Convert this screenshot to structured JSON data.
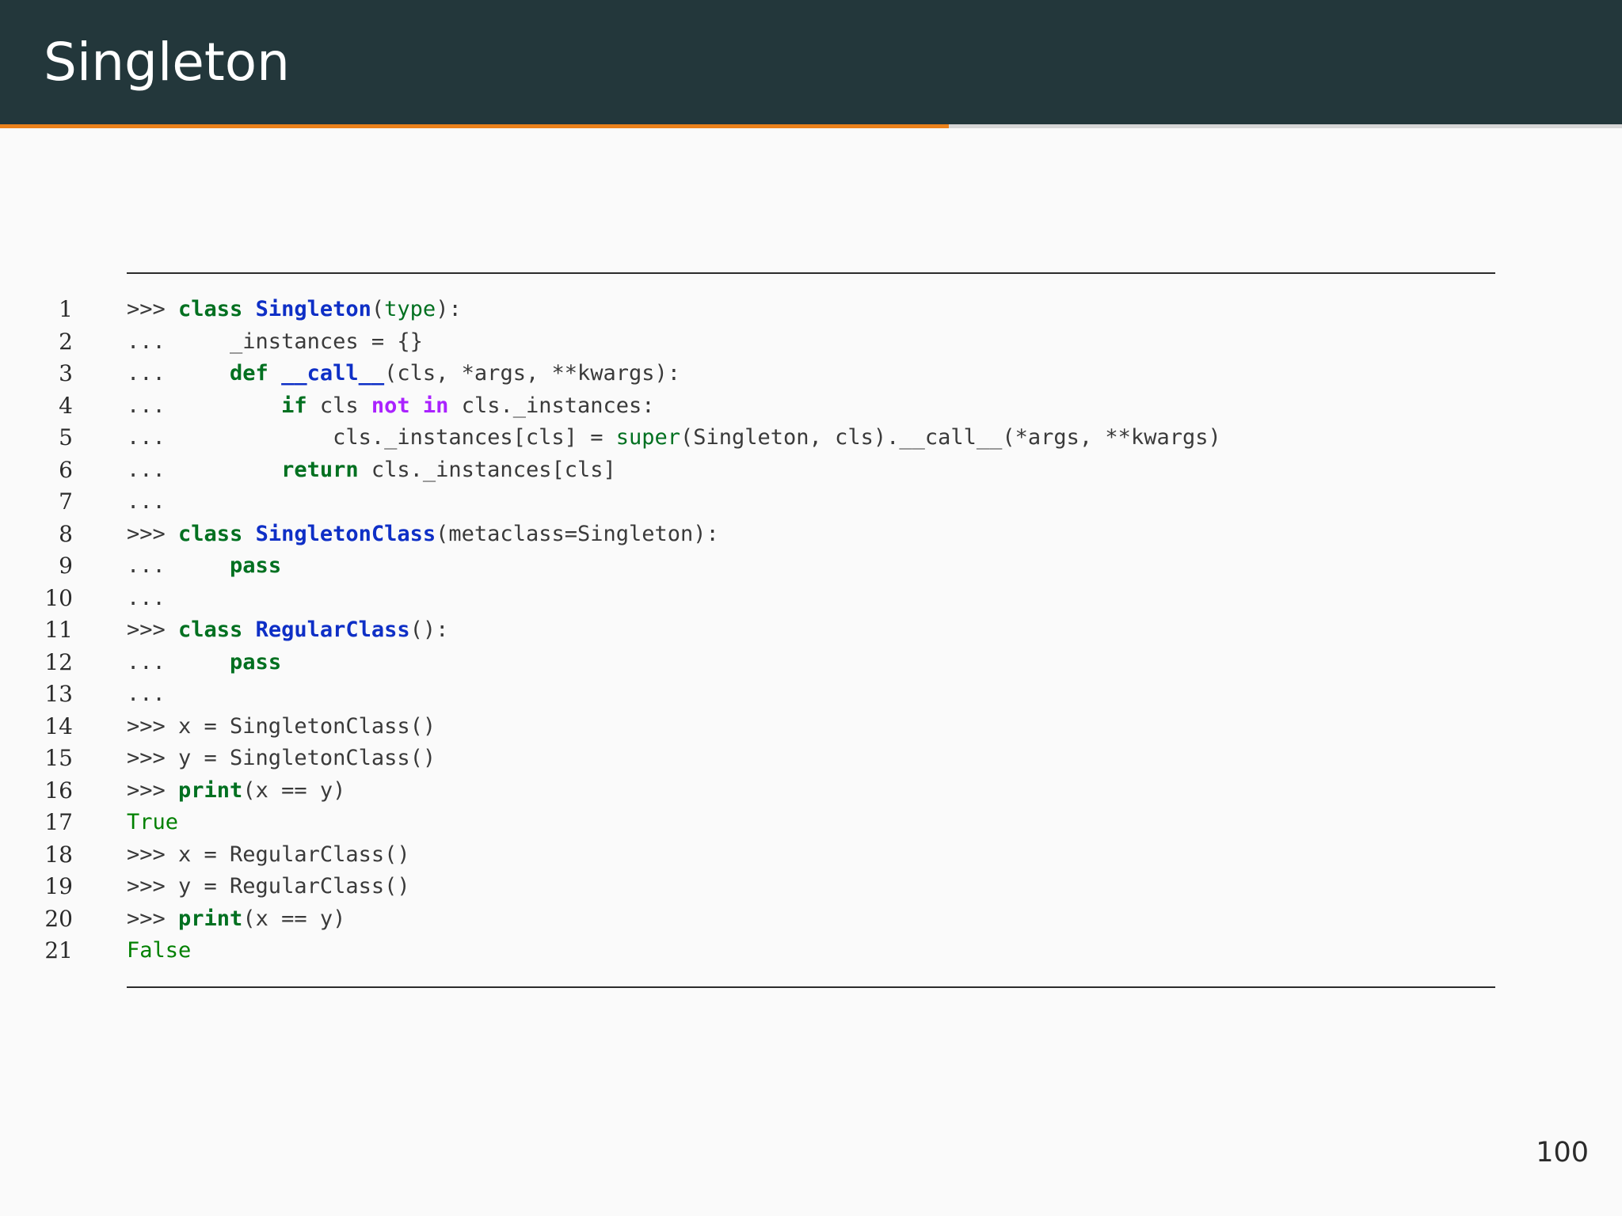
{
  "slide": {
    "title": "Singleton",
    "page_number": "100",
    "progress_fraction": 0.585,
    "colors": {
      "header_bg": "#23373b",
      "accent": "#eb811b",
      "keyword": "#007020",
      "class_name": "#0e2fc6",
      "operator": "#aa22ff"
    }
  },
  "code": {
    "lines": [
      {
        "n": "1",
        "parts": [
          {
            "t": ">>> "
          },
          {
            "t": "class",
            "c": "kw"
          },
          {
            "t": " "
          },
          {
            "t": "Singleton",
            "c": "nc"
          },
          {
            "t": "("
          },
          {
            "t": "type",
            "c": "nb"
          },
          {
            "t": "):"
          }
        ]
      },
      {
        "n": "2",
        "parts": [
          {
            "t": "...     _instances = {}"
          }
        ]
      },
      {
        "n": "3",
        "parts": [
          {
            "t": "...     "
          },
          {
            "t": "def",
            "c": "kw"
          },
          {
            "t": " "
          },
          {
            "t": "__call__",
            "c": "nc"
          },
          {
            "t": "(cls, *args, **kwargs):"
          }
        ]
      },
      {
        "n": "4",
        "parts": [
          {
            "t": "...         "
          },
          {
            "t": "if",
            "c": "kw"
          },
          {
            "t": " cls "
          },
          {
            "t": "not",
            "c": "op"
          },
          {
            "t": " "
          },
          {
            "t": "in",
            "c": "op"
          },
          {
            "t": " cls._instances:"
          }
        ]
      },
      {
        "n": "5",
        "parts": [
          {
            "t": "...             cls._instances[cls] = "
          },
          {
            "t": "super",
            "c": "nb"
          },
          {
            "t": "(Singleton, cls).__call__(*args, **kwargs)"
          }
        ]
      },
      {
        "n": "6",
        "parts": [
          {
            "t": "...         "
          },
          {
            "t": "return",
            "c": "kw"
          },
          {
            "t": " cls._instances[cls]"
          }
        ]
      },
      {
        "n": "7",
        "parts": [
          {
            "t": "..."
          }
        ]
      },
      {
        "n": "8",
        "parts": [
          {
            "t": ">>> "
          },
          {
            "t": "class",
            "c": "kw"
          },
          {
            "t": " "
          },
          {
            "t": "SingletonClass",
            "c": "nc"
          },
          {
            "t": "(metaclass=Singleton):"
          }
        ]
      },
      {
        "n": "9",
        "parts": [
          {
            "t": "...     "
          },
          {
            "t": "pass",
            "c": "kw"
          }
        ]
      },
      {
        "n": "10",
        "parts": [
          {
            "t": "..."
          }
        ]
      },
      {
        "n": "11",
        "parts": [
          {
            "t": ">>> "
          },
          {
            "t": "class",
            "c": "kw"
          },
          {
            "t": " "
          },
          {
            "t": "RegularClass",
            "c": "nc"
          },
          {
            "t": "():"
          }
        ]
      },
      {
        "n": "12",
        "parts": [
          {
            "t": "...     "
          },
          {
            "t": "pass",
            "c": "kw"
          }
        ]
      },
      {
        "n": "13",
        "parts": [
          {
            "t": "..."
          }
        ]
      },
      {
        "n": "14",
        "parts": [
          {
            "t": ">>> x = SingletonClass()"
          }
        ]
      },
      {
        "n": "15",
        "parts": [
          {
            "t": ">>> y = SingletonClass()"
          }
        ]
      },
      {
        "n": "16",
        "parts": [
          {
            "t": ">>> "
          },
          {
            "t": "print",
            "c": "kw"
          },
          {
            "t": "(x == y)"
          }
        ]
      },
      {
        "n": "17",
        "parts": [
          {
            "t": "True",
            "c": "go"
          }
        ]
      },
      {
        "n": "18",
        "parts": [
          {
            "t": ">>> x = RegularClass()"
          }
        ]
      },
      {
        "n": "19",
        "parts": [
          {
            "t": ">>> y = RegularClass()"
          }
        ]
      },
      {
        "n": "20",
        "parts": [
          {
            "t": ">>> "
          },
          {
            "t": "print",
            "c": "kw"
          },
          {
            "t": "(x == y)"
          }
        ]
      },
      {
        "n": "21",
        "parts": [
          {
            "t": "False",
            "c": "go"
          }
        ]
      }
    ]
  }
}
